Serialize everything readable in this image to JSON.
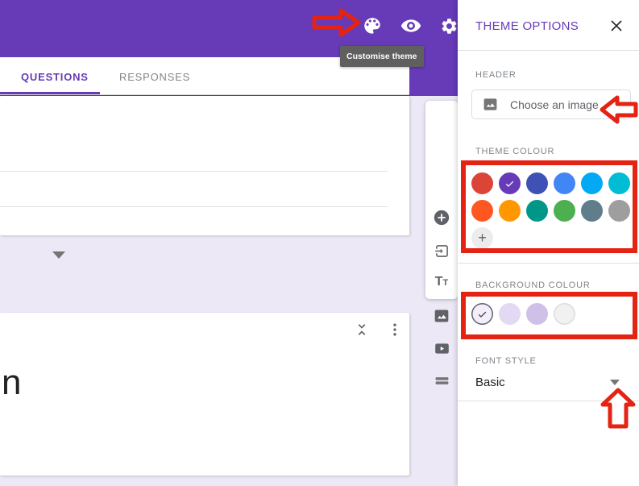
{
  "colors": {
    "app_bar": "#673ab7",
    "page_background": "#ece8f6",
    "annotation_red": "#e42313",
    "accent_purple": "#673ab7"
  },
  "app_bar": {
    "tooltip": "Customise theme",
    "icons": [
      "palette",
      "preview-eye",
      "settings-gear"
    ]
  },
  "tabs": {
    "questions": "QUESTIONS",
    "responses": "RESPONSES"
  },
  "editor": {
    "question_text_fragment": "n",
    "toolbar_icons": [
      "add-question",
      "import-questions",
      "add-title-and-description",
      "add-image",
      "add-video",
      "add-section"
    ]
  },
  "theme_panel": {
    "title": "THEME OPTIONS",
    "header_section": {
      "label": "HEADER",
      "button_label": "Choose an image"
    },
    "theme_colour_section": {
      "label": "THEME COLOUR",
      "swatches": [
        "#db4437",
        "#673ab7",
        "#3f51b5",
        "#4285f4",
        "#03a9f4",
        "#00bcd4",
        "#ff5722",
        "#ff9800",
        "#009688",
        "#4caf50",
        "#607d8b",
        "#9e9e9e"
      ],
      "selected_index": 1,
      "add_button": "+"
    },
    "background_colour_section": {
      "label": "BACKGROUND COLOUR",
      "swatches": [
        {
          "fill": "#f3eefa",
          "border": "#5f6368",
          "selected": true
        },
        {
          "fill": "#e3d9f2",
          "border": null,
          "selected": false
        },
        {
          "fill": "#cfc0e8",
          "border": null,
          "selected": false
        },
        {
          "fill": "#f2f1f2",
          "border": "#dadce0",
          "selected": false
        }
      ]
    },
    "font_style_section": {
      "label": "FONT STYLE",
      "value": "Basic"
    }
  }
}
